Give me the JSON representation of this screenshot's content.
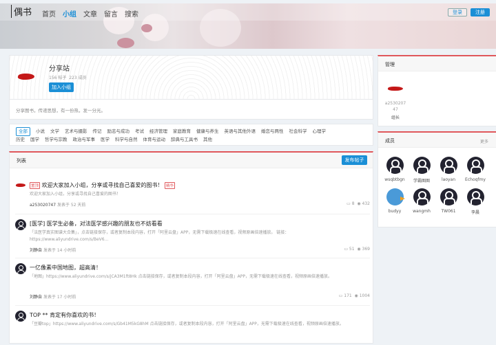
{
  "nav": {
    "logo": "偶书",
    "items": [
      "首页",
      "小组",
      "文章",
      "留言",
      "搜索"
    ],
    "active": 1,
    "login": "登录",
    "register": "注册"
  },
  "group": {
    "name": "分享站",
    "posts": "156 帖子",
    "members": "223 成员",
    "join": "加入小组",
    "description": "分享图书，传递思想，有一份热，发一分光。"
  },
  "categories": [
    "全部",
    "小说",
    "文学",
    "艺术与摄影",
    "传记",
    "励志与成功",
    "考试",
    "经济管理",
    "家庭教育",
    "健康与养生",
    "英语与其他外语",
    "婚恋与两性",
    "社会科学",
    "心理学",
    "历史",
    "国学",
    "哲学与宗教",
    "政治与军事",
    "医学",
    "科学与自然",
    "体育与运动",
    "辞典与工具书",
    "其他"
  ],
  "list": {
    "title": "列表",
    "publish": "发布帖子"
  },
  "posts": [
    {
      "tag": "置顶",
      "title": "欢迎大家加入小组，分享或寻找自己喜爱的图书！",
      "badge": "精华",
      "body": "欢迎大家加入小组，分享或寻找自己喜爱的图书！",
      "author": "a253020747",
      "time": "发表于 52 天前",
      "comments": "8",
      "views": "432"
    },
    {
      "title": "[医学] 医学生必备，对法医学感兴趣的朋友也不妨看看",
      "body": "「法医学真实图谱大合集」，点击链接保存，或者复制本段内容，打开「阿里云盘」APP，无需下载极速在线查看，视频原画倍速播放。 链接：https://www.aliyundrive.com/s/BeV6...",
      "author": "刘静自",
      "time": "发表于 14 小时前",
      "comments": "51",
      "views": "369"
    },
    {
      "title": "一亿像素中国地图，超高清！",
      "body": "「地图」https://www.aliyundrive.com/s/jCA3M1ft8Hk 点击链接保存，或者复制本段内容，打开「阿里云盘」APP，无需下载极速在线查看，视频原画倍速播放。",
      "author": "刘静自",
      "time": "发表于 17 小时前",
      "comments": "171",
      "views": "1004"
    },
    {
      "title": "TOP ** 肯定有你喜欢的书！",
      "body": "「豆瓣top」https://www.aliyundrive.com/s/Gb41M5kG8hM 点击链接保存，或者复制本段内容，打开「阿里云盘」APP，无需下载极速在线查看，视频原画倍速播放。"
    }
  ],
  "admin": {
    "title": "管理",
    "name": "a253020747",
    "role": "组长"
  },
  "members": {
    "title": "成员",
    "more": "更多",
    "list": [
      "wsqbtbgn",
      "学霸图图",
      "laoyan",
      "Echoqfmy",
      "budyy",
      "wangmh",
      "TW061",
      "李晨"
    ]
  }
}
